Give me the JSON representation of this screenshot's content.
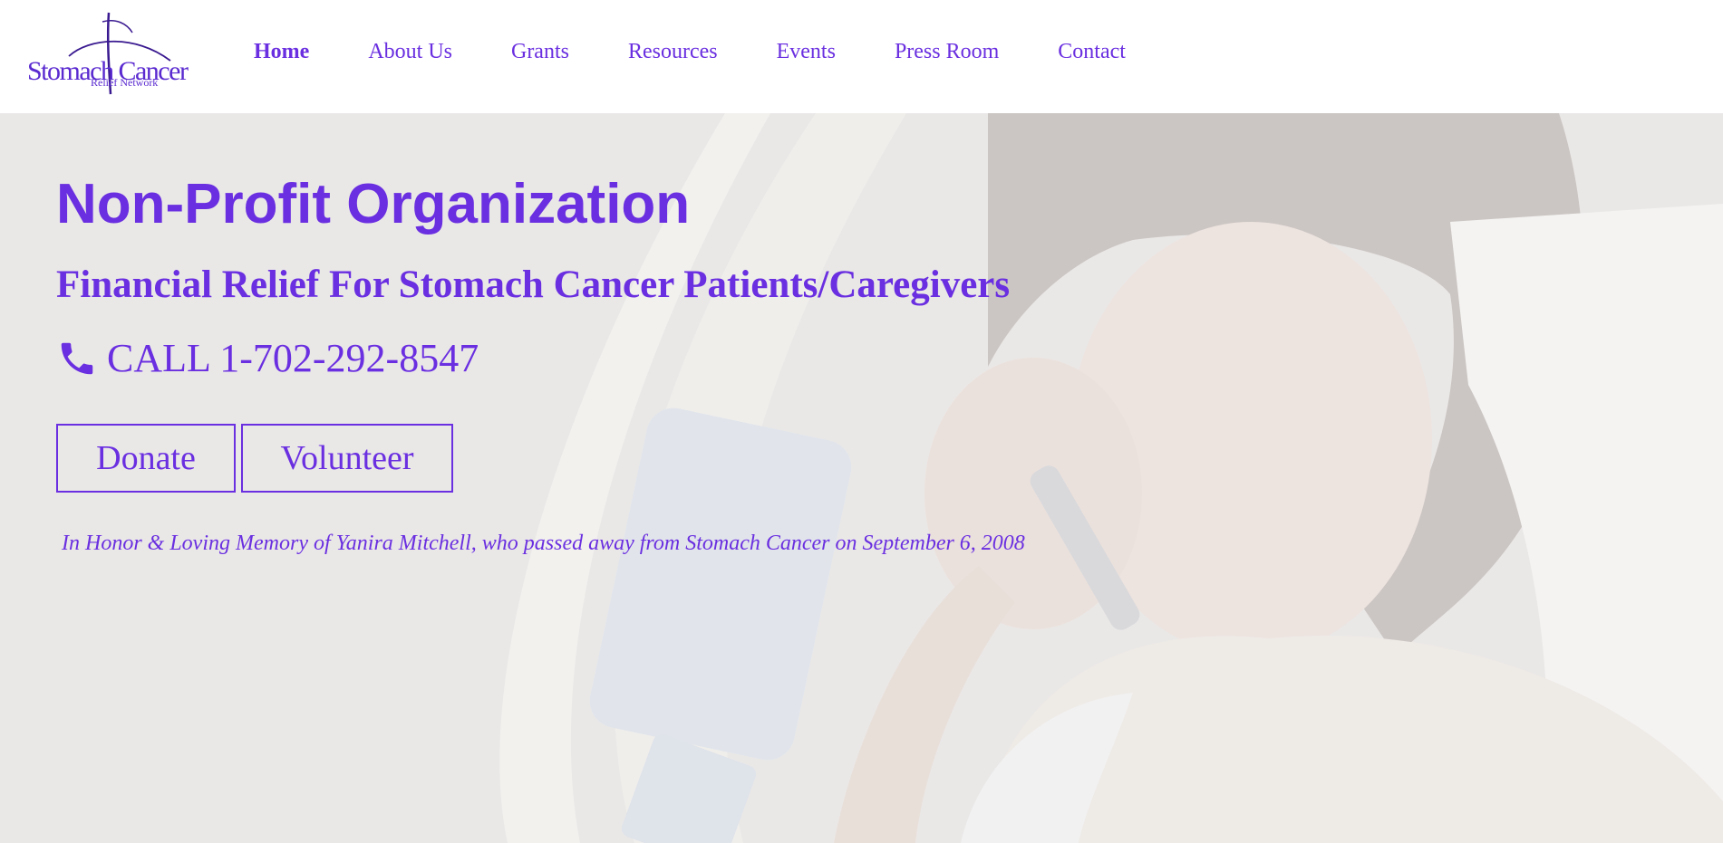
{
  "logo": {
    "main_text": "Stomach Cancer",
    "sub_text": "Relief Network"
  },
  "nav": {
    "items": [
      {
        "label": "Home",
        "active": true
      },
      {
        "label": "About Us",
        "active": false
      },
      {
        "label": "Grants",
        "active": false
      },
      {
        "label": "Resources",
        "active": false
      },
      {
        "label": "Events",
        "active": false
      },
      {
        "label": "Press Room",
        "active": false
      },
      {
        "label": "Contact",
        "active": false
      }
    ]
  },
  "hero": {
    "title": "Non-Profit Organization",
    "subtitle": "Financial Relief For Stomach Cancer Patients/Caregivers",
    "phone": "CALL 1-702-292-8547",
    "phone_icon": "phone-icon",
    "buttons": {
      "donate": "Donate",
      "volunteer": "Volunteer"
    },
    "memorial": "In Honor & Loving Memory of Yanira Mitchell, who passed away from Stomach Cancer on September 6, 2008"
  },
  "colors": {
    "accent": "#6a2fe0",
    "hero_bg": "#e6e4e3",
    "header_bg": "#ffffff"
  }
}
